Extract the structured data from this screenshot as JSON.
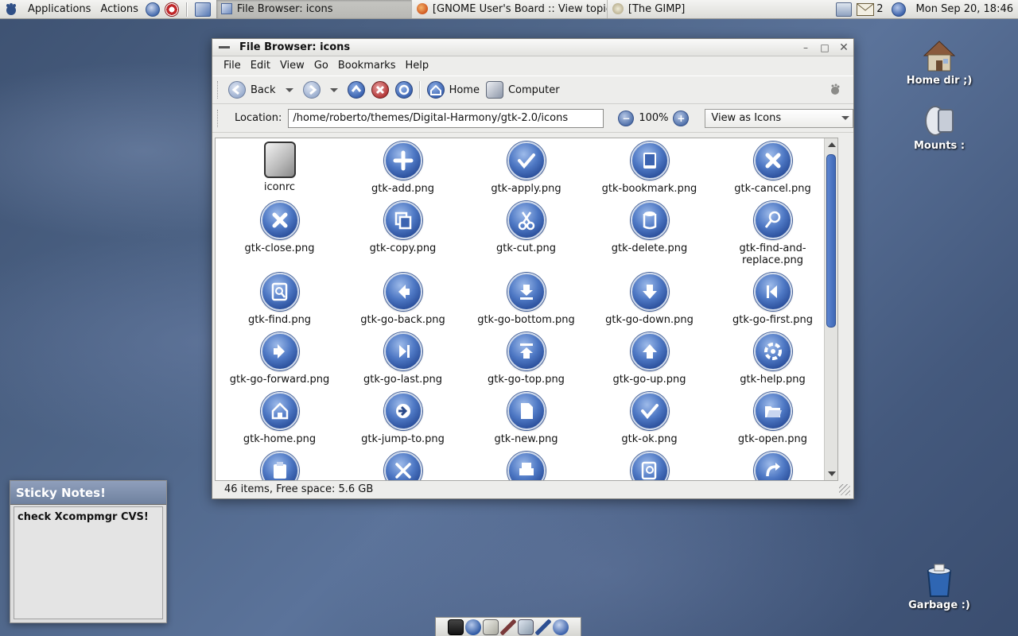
{
  "top_panel": {
    "menus": [
      "Applications",
      "Actions"
    ],
    "tasks": [
      {
        "label": "File Browser: icons",
        "active": true
      },
      {
        "label": "[GNOME User's Board :: View topic -",
        "active": false
      },
      {
        "label": "[The GIMP]",
        "active": false
      }
    ],
    "mail_count": "2",
    "clock": "Mon Sep 20, 18:46"
  },
  "window": {
    "title": "File Browser: icons",
    "menubar": [
      "File",
      "Edit",
      "View",
      "Go",
      "Bookmarks",
      "Help"
    ],
    "toolbar": {
      "back_label": "Back",
      "home_label": "Home",
      "computer_label": "Computer"
    },
    "location": {
      "label": "Location:",
      "value": "/home/roberto/themes/Digital-Harmony/gtk-2.0/icons",
      "zoom": "100%",
      "view_mode": "View as Icons"
    },
    "files": [
      {
        "name": "iconrc",
        "icon": "file-icon"
      },
      {
        "name": "gtk-add.png",
        "icon": "add-icon"
      },
      {
        "name": "gtk-apply.png",
        "icon": "check-icon"
      },
      {
        "name": "gtk-bookmark.png",
        "icon": "bookmark-icon"
      },
      {
        "name": "gtk-cancel.png",
        "icon": "x-icon"
      },
      {
        "name": "gtk-close.png",
        "icon": "x-icon"
      },
      {
        "name": "gtk-copy.png",
        "icon": "copy-icon"
      },
      {
        "name": "gtk-cut.png",
        "icon": "scissors-icon"
      },
      {
        "name": "gtk-delete.png",
        "icon": "trash-icon"
      },
      {
        "name": "gtk-find-and-replace.png",
        "icon": "find-replace-icon"
      },
      {
        "name": "gtk-find.png",
        "icon": "find-icon"
      },
      {
        "name": "gtk-go-back.png",
        "icon": "arrow-left-icon"
      },
      {
        "name": "gtk-go-bottom.png",
        "icon": "arrow-bottom-icon"
      },
      {
        "name": "gtk-go-down.png",
        "icon": "arrow-down-icon"
      },
      {
        "name": "gtk-go-first.png",
        "icon": "arrow-first-icon"
      },
      {
        "name": "gtk-go-forward.png",
        "icon": "arrow-right-icon"
      },
      {
        "name": "gtk-go-last.png",
        "icon": "arrow-last-icon"
      },
      {
        "name": "gtk-go-top.png",
        "icon": "arrow-top-icon"
      },
      {
        "name": "gtk-go-up.png",
        "icon": "arrow-up-icon"
      },
      {
        "name": "gtk-help.png",
        "icon": "lifebuoy-icon"
      },
      {
        "name": "gtk-home.png",
        "icon": "home-icon"
      },
      {
        "name": "gtk-jump-to.png",
        "icon": "jump-icon"
      },
      {
        "name": "gtk-new.png",
        "icon": "new-file-icon"
      },
      {
        "name": "gtk-ok.png",
        "icon": "check-icon"
      },
      {
        "name": "gtk-open.png",
        "icon": "folder-open-icon"
      },
      {
        "name": "",
        "icon": "paste-icon"
      },
      {
        "name": "",
        "icon": "tools-icon"
      },
      {
        "name": "",
        "icon": "print-icon"
      },
      {
        "name": "",
        "icon": "print-preview-icon"
      },
      {
        "name": "",
        "icon": "redo-icon"
      }
    ],
    "status": "46 items, Free space: 5.6 GB"
  },
  "desktop": {
    "icons": [
      {
        "label": "Home dir ;)"
      },
      {
        "label": "Mounts :"
      },
      {
        "label": "Garbage :)"
      }
    ],
    "sticky": {
      "title": "Sticky Notes!",
      "text": "check Xcompmgr CVS!"
    }
  }
}
